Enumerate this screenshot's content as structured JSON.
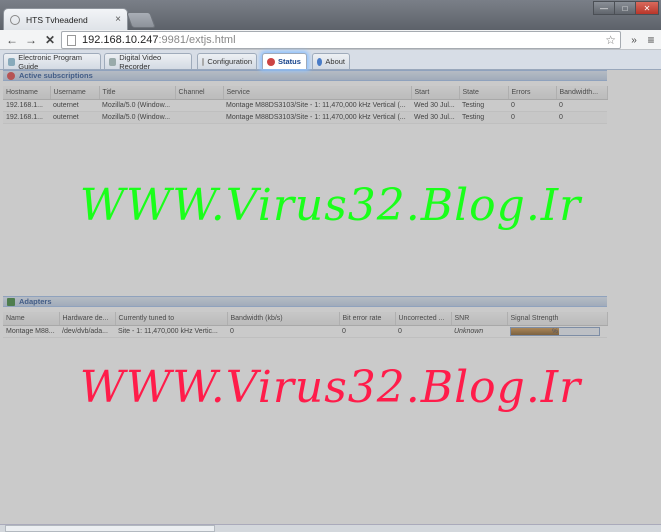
{
  "browser": {
    "tab_title": "HTS Tvheadend",
    "tab_close": "×",
    "url_host": "192.168.10.247",
    "url_path": ":9981/extjs.html",
    "back": "←",
    "forward": "→",
    "stop": "✕",
    "star": "☆",
    "more": "»",
    "menu": "≡",
    "win_min": "—",
    "win_max": "□",
    "win_close": "✕"
  },
  "tabs": [
    {
      "label": "Electronic Program Guide",
      "icon": "epg-icon"
    },
    {
      "label": "Digital Video Recorder",
      "icon": "dvr-icon"
    },
    {
      "label": "Configuration",
      "icon": "wrench-icon"
    },
    {
      "label": "Status",
      "icon": "status-icon",
      "active": true
    },
    {
      "label": "About",
      "icon": "info-icon"
    }
  ],
  "subscriptions": {
    "title": "Active subscriptions",
    "columns": [
      "Hostname",
      "Username",
      "Title",
      "Channel",
      "Service",
      "Start",
      "State",
      "Errors",
      "Bandwidth..."
    ],
    "rows": [
      [
        "192.168.1...",
        "outernet",
        "Mozilla/5.0 (Window...",
        "",
        "Montage M88DS3103/Site - 1: 11,470,000 kHz Vertical (...",
        "Wed 30 Jul...",
        "Testing",
        "0",
        "0"
      ],
      [
        "192.168.1...",
        "outernet",
        "Mozilla/5.0 (Window...",
        "",
        "Montage M88DS3103/Site - 1: 11,470,000 kHz Vertical (...",
        "Wed 30 Jul...",
        "Testing",
        "0",
        "0"
      ]
    ]
  },
  "adapters": {
    "title": "Adapters",
    "columns": [
      "Name",
      "Hardware de...",
      "Currently tuned to",
      "Bandwidth (kb/s)",
      "Bit error rate",
      "Uncorrected ...",
      "SNR",
      "Signal Strength"
    ],
    "row": {
      "name": "Montage M88...",
      "hardware": "/dev/dvb/ada...",
      "tuned": "Site - 1: 11,470,000 kHz Vertic...",
      "bandwidth": "0",
      "ber": "0",
      "uncorrected": "0",
      "snr": "Unknown",
      "signal_text": "%",
      "signal_level": 0.55
    }
  },
  "watermarks": [
    "WWW.Virus32.Blog.Ir",
    "WWW.Virus32.Blog.Ir"
  ],
  "colors": {
    "watermark_green": "#1aff1a",
    "watermark_red": "#ff1c4a",
    "signal_bar": "#a06a24",
    "active_tab_glow": "#8fc2ff"
  }
}
